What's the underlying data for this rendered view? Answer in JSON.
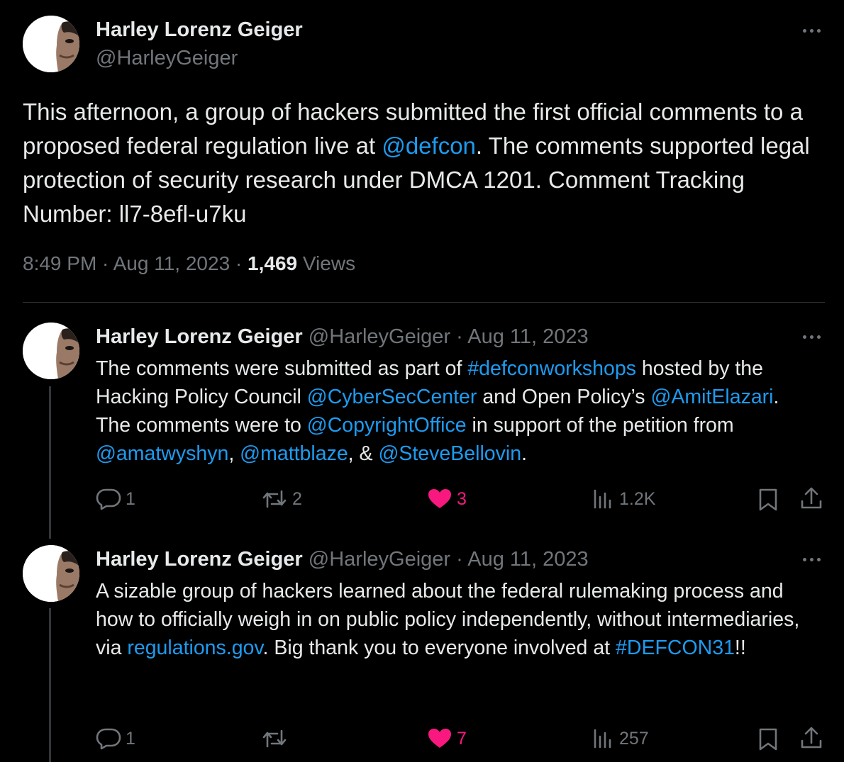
{
  "colors": {
    "background": "#000000",
    "text": "#e7e9ea",
    "muted": "#71767b",
    "link": "#1d9bf0",
    "like": "#f91880",
    "divider": "#2f3336"
  },
  "main_tweet": {
    "author_name": "Harley Lorenz Geiger",
    "author_handle": "@HarleyGeiger",
    "text_part1": "This afternoon, a group of hackers submitted the first official comments to a proposed federal regulation live at ",
    "mention": "@defcon",
    "text_part2": ". The comments supported legal protection of security research under DMCA 1201. Comment Tracking Number: ll7-8efl-u7ku",
    "time": "8:49 PM",
    "date": "Aug 11, 2023",
    "views_count": "1,469",
    "views_label": "Views",
    "more_icon": "more-icon"
  },
  "replies": [
    {
      "author_name": "Harley Lorenz Geiger",
      "author_handle": "@HarleyGeiger",
      "date": "Aug 11, 2023",
      "segments": {
        "t1": "The comments were submitted as part of ",
        "l1": "#defconworkshops",
        "t2": " hosted by the Hacking Policy Council ",
        "l2": "@CyberSecCenter",
        "t3": " and Open Policy’s ",
        "l3": "@AmitElazari",
        "t4": ". The comments were to ",
        "l4": "@CopyrightOffice",
        "t5": " in support of the petition from ",
        "l5": "@amatwyshyn",
        "t6": ", ",
        "l6": "@mattblaze",
        "t7": ", & ",
        "l7": "@SteveBellovin",
        "t8": "."
      },
      "replies_count": "1",
      "reposts_count": "2",
      "likes_count": "3",
      "views_count": "1.2K"
    },
    {
      "author_name": "Harley Lorenz Geiger",
      "author_handle": "@HarleyGeiger",
      "date": "Aug 11, 2023",
      "segments": {
        "t1": "A sizable group of hackers learned about the federal rulemaking process and how to officially weigh in on public policy independently, without intermediaries, via ",
        "l1": "regulations.gov",
        "t2": ". Big thank you to everyone involved at ",
        "l2": "#DEFCON31",
        "t3": "!!"
      },
      "replies_count": "1",
      "reposts_count": "",
      "likes_count": "7",
      "views_count": "257"
    }
  ],
  "separator": " · "
}
